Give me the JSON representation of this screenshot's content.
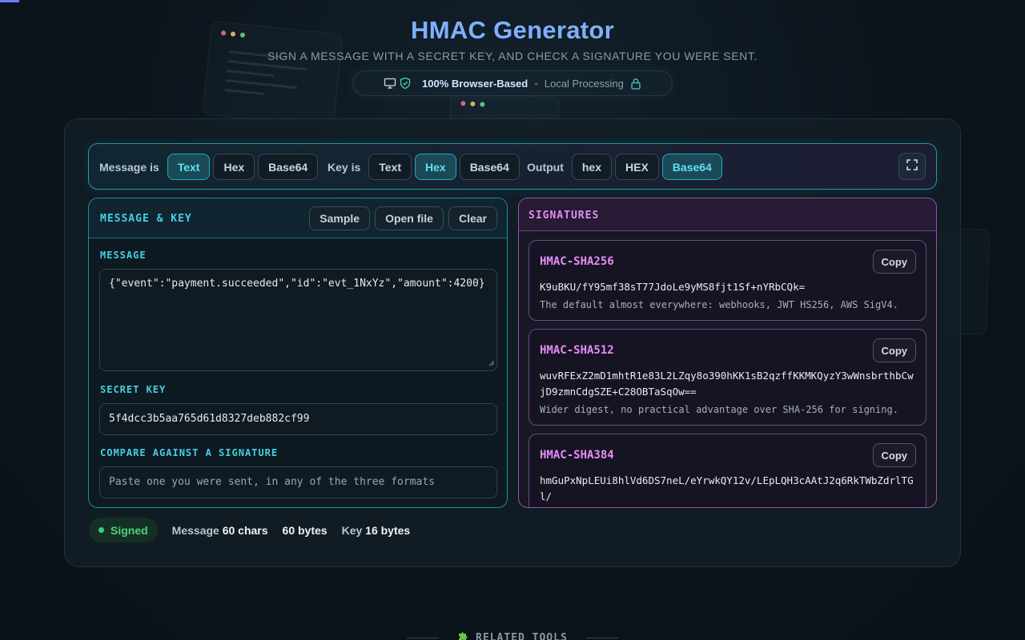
{
  "header": {
    "title": "HMAC Generator",
    "subtitle": "SIGN A MESSAGE WITH A SECRET KEY, AND CHECK A SIGNATURE YOU WERE SENT.",
    "badge_primary": "100% Browser-Based",
    "badge_separator": "•",
    "badge_secondary": "Local Processing"
  },
  "toolbar": {
    "message_label": "Message is",
    "message_options": [
      "Text",
      "Hex",
      "Base64"
    ],
    "message_selected": "Text",
    "key_label": "Key is",
    "key_options": [
      "Text",
      "Hex",
      "Base64"
    ],
    "key_selected": "Hex",
    "output_label": "Output",
    "output_options": [
      "hex",
      "HEX",
      "Base64"
    ],
    "output_selected": "Base64"
  },
  "input_panel": {
    "title": "MESSAGE & KEY",
    "buttons": {
      "sample": "Sample",
      "open_file": "Open file",
      "clear": "Clear"
    },
    "message_label": "MESSAGE",
    "message_value": "{\"event\":\"payment.succeeded\",\"id\":\"evt_1NxYz\",\"amount\":4200}",
    "key_label": "SECRET KEY",
    "key_value": "5f4dcc3b5aa765d61d8327deb882cf99",
    "compare_label": "COMPARE AGAINST A SIGNATURE",
    "compare_placeholder": "Paste one you were sent, in any of the three formats"
  },
  "signatures_panel": {
    "title": "SIGNATURES",
    "copy_label": "Copy",
    "items": [
      {
        "name": "HMAC-SHA256",
        "value": "K9uBKU/fY95mf38sT77JdoLe9yMS8fjt1Sf+nYRbCQk=",
        "note": "The default almost everywhere: webhooks, JWT HS256, AWS SigV4."
      },
      {
        "name": "HMAC-SHA512",
        "value": "wuvRFExZ2mD1mhtR1e83L2LZqy8o390hKK1sB2qzffKKMKQyzY3wWnsbrthbCwjD9zmnCdgSZE+C28OBTaSqOw==",
        "note": "Wider digest, no practical advantage over SHA-256 for signing."
      },
      {
        "name": "HMAC-SHA384",
        "value": "hmGuPxNpLEUi8hlVd6DS7neL/eYrwkQY12v/LEpLQH3cAAtJ2q6RkTWbZdrlTGl/",
        "note": ""
      }
    ]
  },
  "status": {
    "badge": "Signed",
    "message_prefix": "Message",
    "message_count": "60 chars",
    "bytes_count": "60 bytes",
    "key_prefix": "Key",
    "key_count": "16 bytes"
  },
  "related": {
    "label": "RELATED TOOLS"
  },
  "colors": {
    "accent_cyan": "#46cfe0",
    "accent_purple": "#e48df5",
    "title_blue": "#7fb0ff",
    "success": "#4fd07f"
  }
}
